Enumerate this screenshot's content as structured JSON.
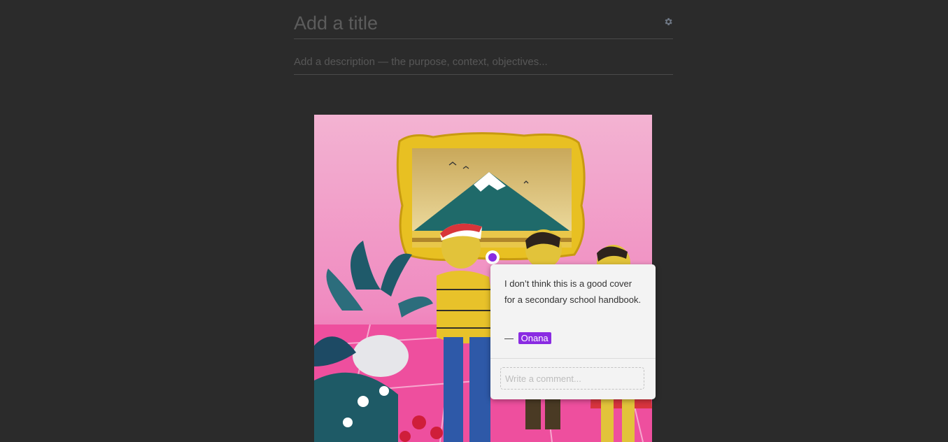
{
  "header": {
    "title_placeholder": "Add a title",
    "description_placeholder": "Add a description — the purpose, context, objectives..."
  },
  "toolbar": {
    "settings_icon": "gear-icon"
  },
  "artwork": {
    "description_icon": "painting-image"
  },
  "annotation": {
    "comment": "I don’t think this is a good cover for a secondary school handbook.",
    "author_prefix": "—",
    "author": "Onana",
    "reply_placeholder": "Write a comment...",
    "accent_color": "#8a2be2"
  }
}
